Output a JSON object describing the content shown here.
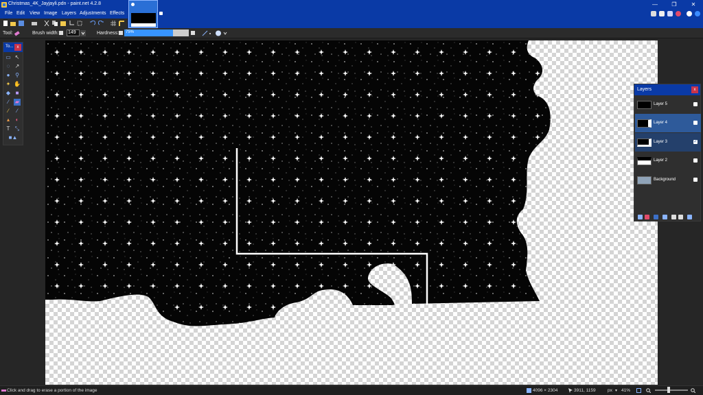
{
  "window": {
    "title": "Christmas_4K_Jayjayli.pdn - paint.net 4.2.8",
    "minimize": "—",
    "restore": "❐",
    "close": "✕"
  },
  "menu": [
    "File",
    "Edit",
    "View",
    "Image",
    "Layers",
    "Adjustments",
    "Effects"
  ],
  "toolbar": {
    "tool_label": "Tool:",
    "brush_width_label": "Brush width:",
    "brush_width_value": "149",
    "hardness_label": "Hardness:",
    "hardness_value": "75%",
    "hardness_fraction": 0.75
  },
  "tools_panel": {
    "title": "To...",
    "close": "x"
  },
  "layers_panel": {
    "title": "Layers",
    "close": "x",
    "layers": [
      {
        "name": "Layer 5",
        "visible": false,
        "selected": false
      },
      {
        "name": "Layer 4",
        "visible": false,
        "selected": true
      },
      {
        "name": "Layer 3",
        "visible": true,
        "selected": false
      },
      {
        "name": "Layer 2",
        "visible": false,
        "selected": false
      },
      {
        "name": "Background",
        "visible": false,
        "selected": false
      }
    ]
  },
  "status": {
    "hint": "Click and drag to erase a portion of the image",
    "image_size": "4096 × 2304",
    "cursor_pos": "3911, 1159",
    "units": "px",
    "zoom": "41%"
  },
  "colors": {
    "title_blue": "#0a3aa6",
    "accent": "#3794ff",
    "canvas_black": "#000000"
  }
}
